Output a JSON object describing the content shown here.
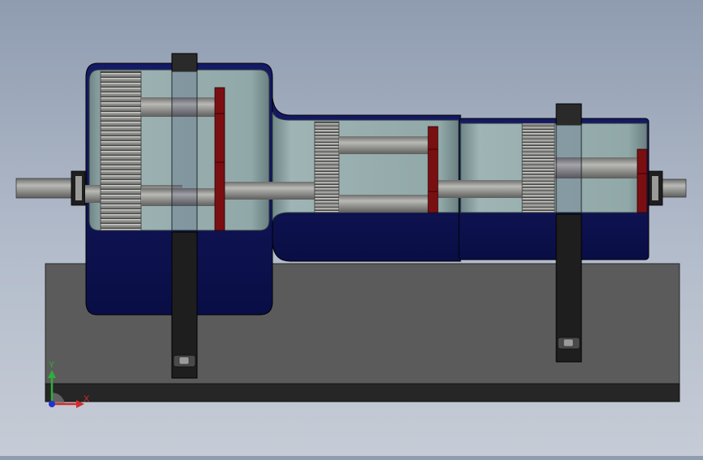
{
  "viewport": {
    "colors": {
      "background_top": "#8f9cb0",
      "background_bottom": "#c6ccd6",
      "housing_blue": "#0d1255",
      "housing_edge": "#1a237e",
      "glass": "#8fa6a6",
      "base": "#5b5b5b",
      "base_bottom": "#262626",
      "shaft": "#9a9a98",
      "gear_red": "#7a0f12",
      "bracket": "#1e1e1e"
    }
  },
  "triad": {
    "x_label": "X",
    "y_label": "Y",
    "x_color": "#d42b2b",
    "y_color": "#2fae3a",
    "origin_color": "#2233cc"
  }
}
